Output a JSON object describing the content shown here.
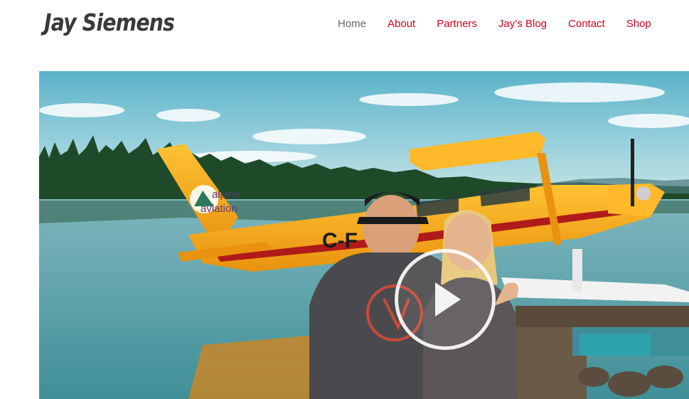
{
  "site": {
    "logo_text": "Jay Siemens"
  },
  "nav": {
    "items": [
      {
        "label": "Home",
        "active": true
      },
      {
        "label": "About",
        "active": false
      },
      {
        "label": "Partners",
        "active": false
      },
      {
        "label": "Jay’s Blog",
        "active": false
      },
      {
        "label": "Contact",
        "active": false
      },
      {
        "label": "Shop",
        "active": false
      }
    ]
  },
  "hero": {
    "video_thumbnail": {
      "plane_logo_line1": "alpine",
      "plane_logo_line2": "aviation",
      "plane_registration": "C-F"
    },
    "play_icon": "play-icon"
  },
  "colors": {
    "nav_link": "#d0021b",
    "nav_active": "#666666",
    "logo": "#3a3a3a",
    "plane_yellow": "#f7a81b"
  }
}
